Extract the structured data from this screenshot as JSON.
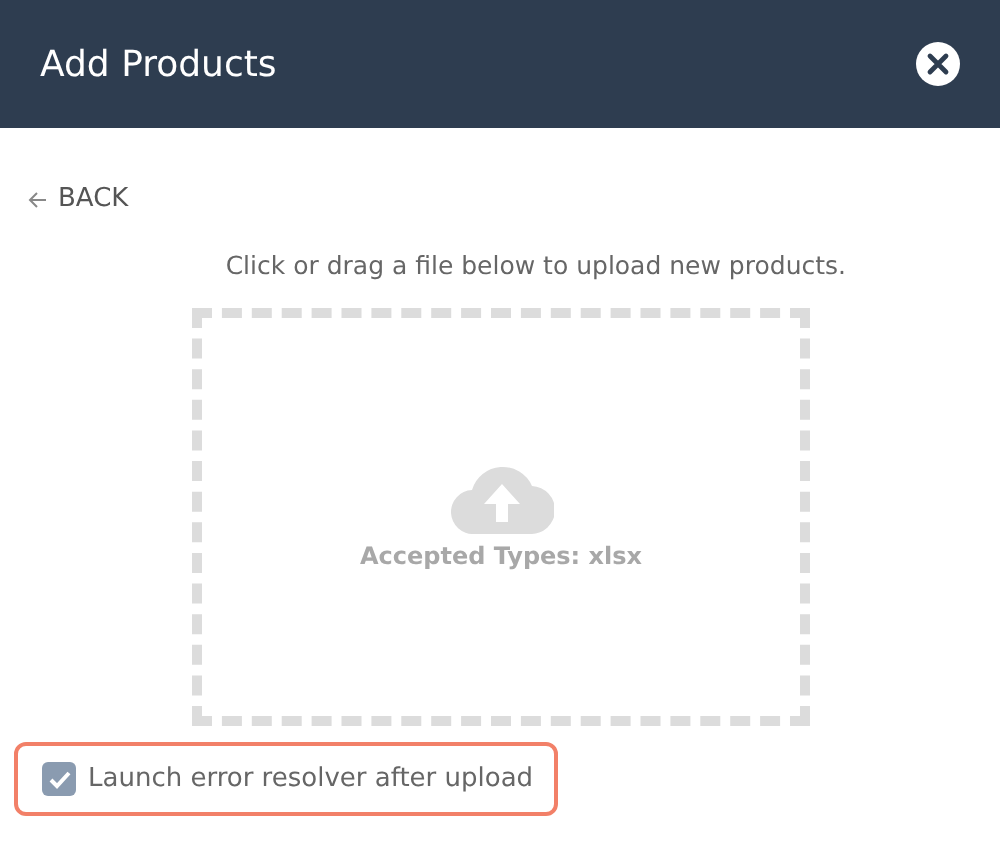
{
  "header": {
    "title": "Add Products"
  },
  "back_link": {
    "label": "BACK"
  },
  "instruction": "Click or drag a file below to upload new products.",
  "dropzone": {
    "accepted_types": "Accepted Types: xlsx"
  },
  "option": {
    "label": "Launch error resolver after upload",
    "checked": true,
    "highlighted": true
  }
}
